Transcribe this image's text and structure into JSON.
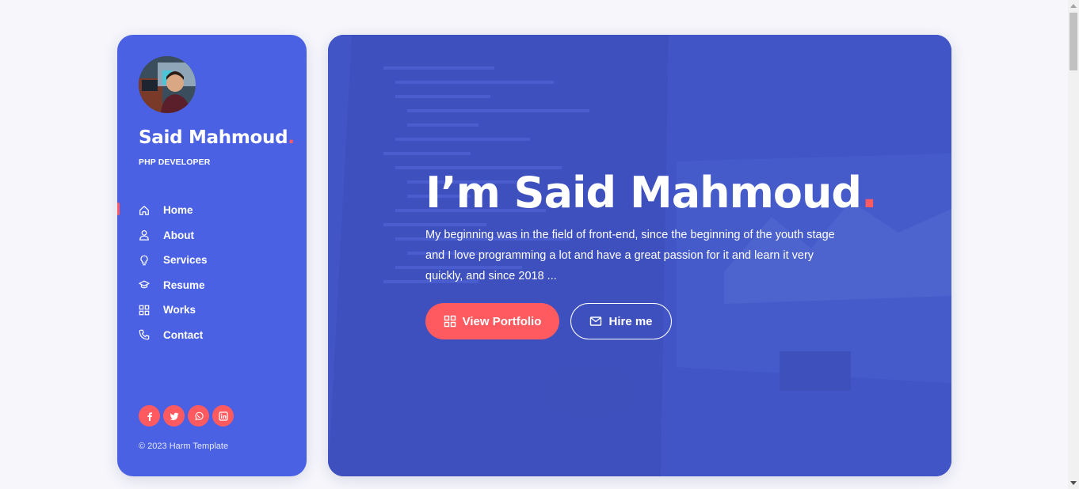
{
  "profile": {
    "name": "Said Mahmoud",
    "name_dot": ".",
    "role": "PHP DEVELOPER",
    "avatar_alt": "profile photo"
  },
  "nav": {
    "items": [
      {
        "label": "Home",
        "icon": "home-icon",
        "active": true
      },
      {
        "label": "About",
        "icon": "user-icon",
        "active": false
      },
      {
        "label": "Services",
        "icon": "bulb-icon",
        "active": false
      },
      {
        "label": "Resume",
        "icon": "graduation-cap-icon",
        "active": false
      },
      {
        "label": "Works",
        "icon": "grid-icon",
        "active": false
      },
      {
        "label": "Contact",
        "icon": "phone-icon",
        "active": false
      }
    ]
  },
  "socials": [
    {
      "icon": "facebook-icon"
    },
    {
      "icon": "twitter-icon"
    },
    {
      "icon": "whatsapp-icon"
    },
    {
      "icon": "linkedin-icon"
    }
  ],
  "footer": {
    "copyright": "© 2023 Harm Template"
  },
  "hero": {
    "title": "I’m Said Mahmoud",
    "title_dot": ".",
    "description": "My beginning was in the field of front-end, since the beginning of the youth stage and I love programming a lot and have a great passion for it and learn it very quickly, and since 2018 ...",
    "btn_portfolio": "View Portfolio",
    "btn_portfolio_icon": "grid-icon",
    "btn_hire": "Hire me",
    "btn_hire_icon": "mail-icon"
  },
  "colors": {
    "primary": "#4a61e3",
    "accent": "#ff5a5f",
    "background": "#f6f6fb"
  }
}
